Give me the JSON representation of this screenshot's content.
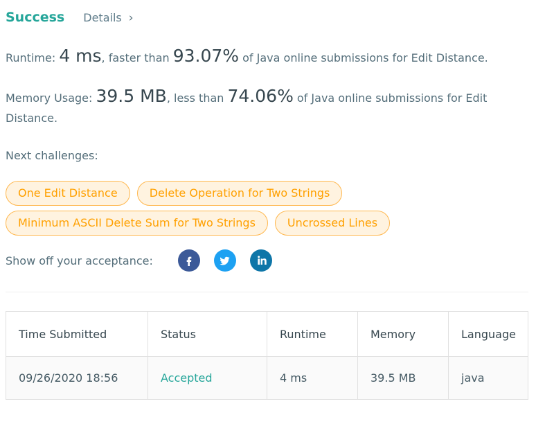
{
  "header": {
    "status": "Success",
    "details_label": "Details",
    "details_chevron": "›"
  },
  "runtime": {
    "prefix": "Runtime: ",
    "value": "4 ms",
    "middle": ", faster than ",
    "percent": "93.07%",
    "suffix": " of Java online submissions for Edit Distance."
  },
  "memory": {
    "prefix": "Memory Usage: ",
    "value": "39.5 MB",
    "middle": ", less than ",
    "percent": "74.06%",
    "suffix": " of Java online submissions for Edit Distance."
  },
  "next_challenges": {
    "label": "Next challenges:",
    "items": [
      "One Edit Distance",
      "Delete Operation for Two Strings",
      "Minimum ASCII Delete Sum for Two Strings",
      "Uncrossed Lines"
    ]
  },
  "share": {
    "label": "Show off your acceptance:",
    "networks": [
      "facebook-icon",
      "twitter-icon",
      "linkedin-icon"
    ],
    "colors": {
      "facebook": "#3b5998",
      "twitter": "#1da1f2",
      "linkedin": "#0e76a8"
    }
  },
  "submissions": {
    "headers": [
      "Time Submitted",
      "Status",
      "Runtime",
      "Memory",
      "Language"
    ],
    "rows": [
      [
        "09/26/2020 18:56",
        "Accepted",
        "4 ms",
        "39.5 MB",
        "java"
      ]
    ]
  },
  "colors": {
    "success": "#26a69a",
    "chip_text": "#ffa000",
    "chip_border": "#ffb74d",
    "chip_bg": "#fff3e0"
  }
}
